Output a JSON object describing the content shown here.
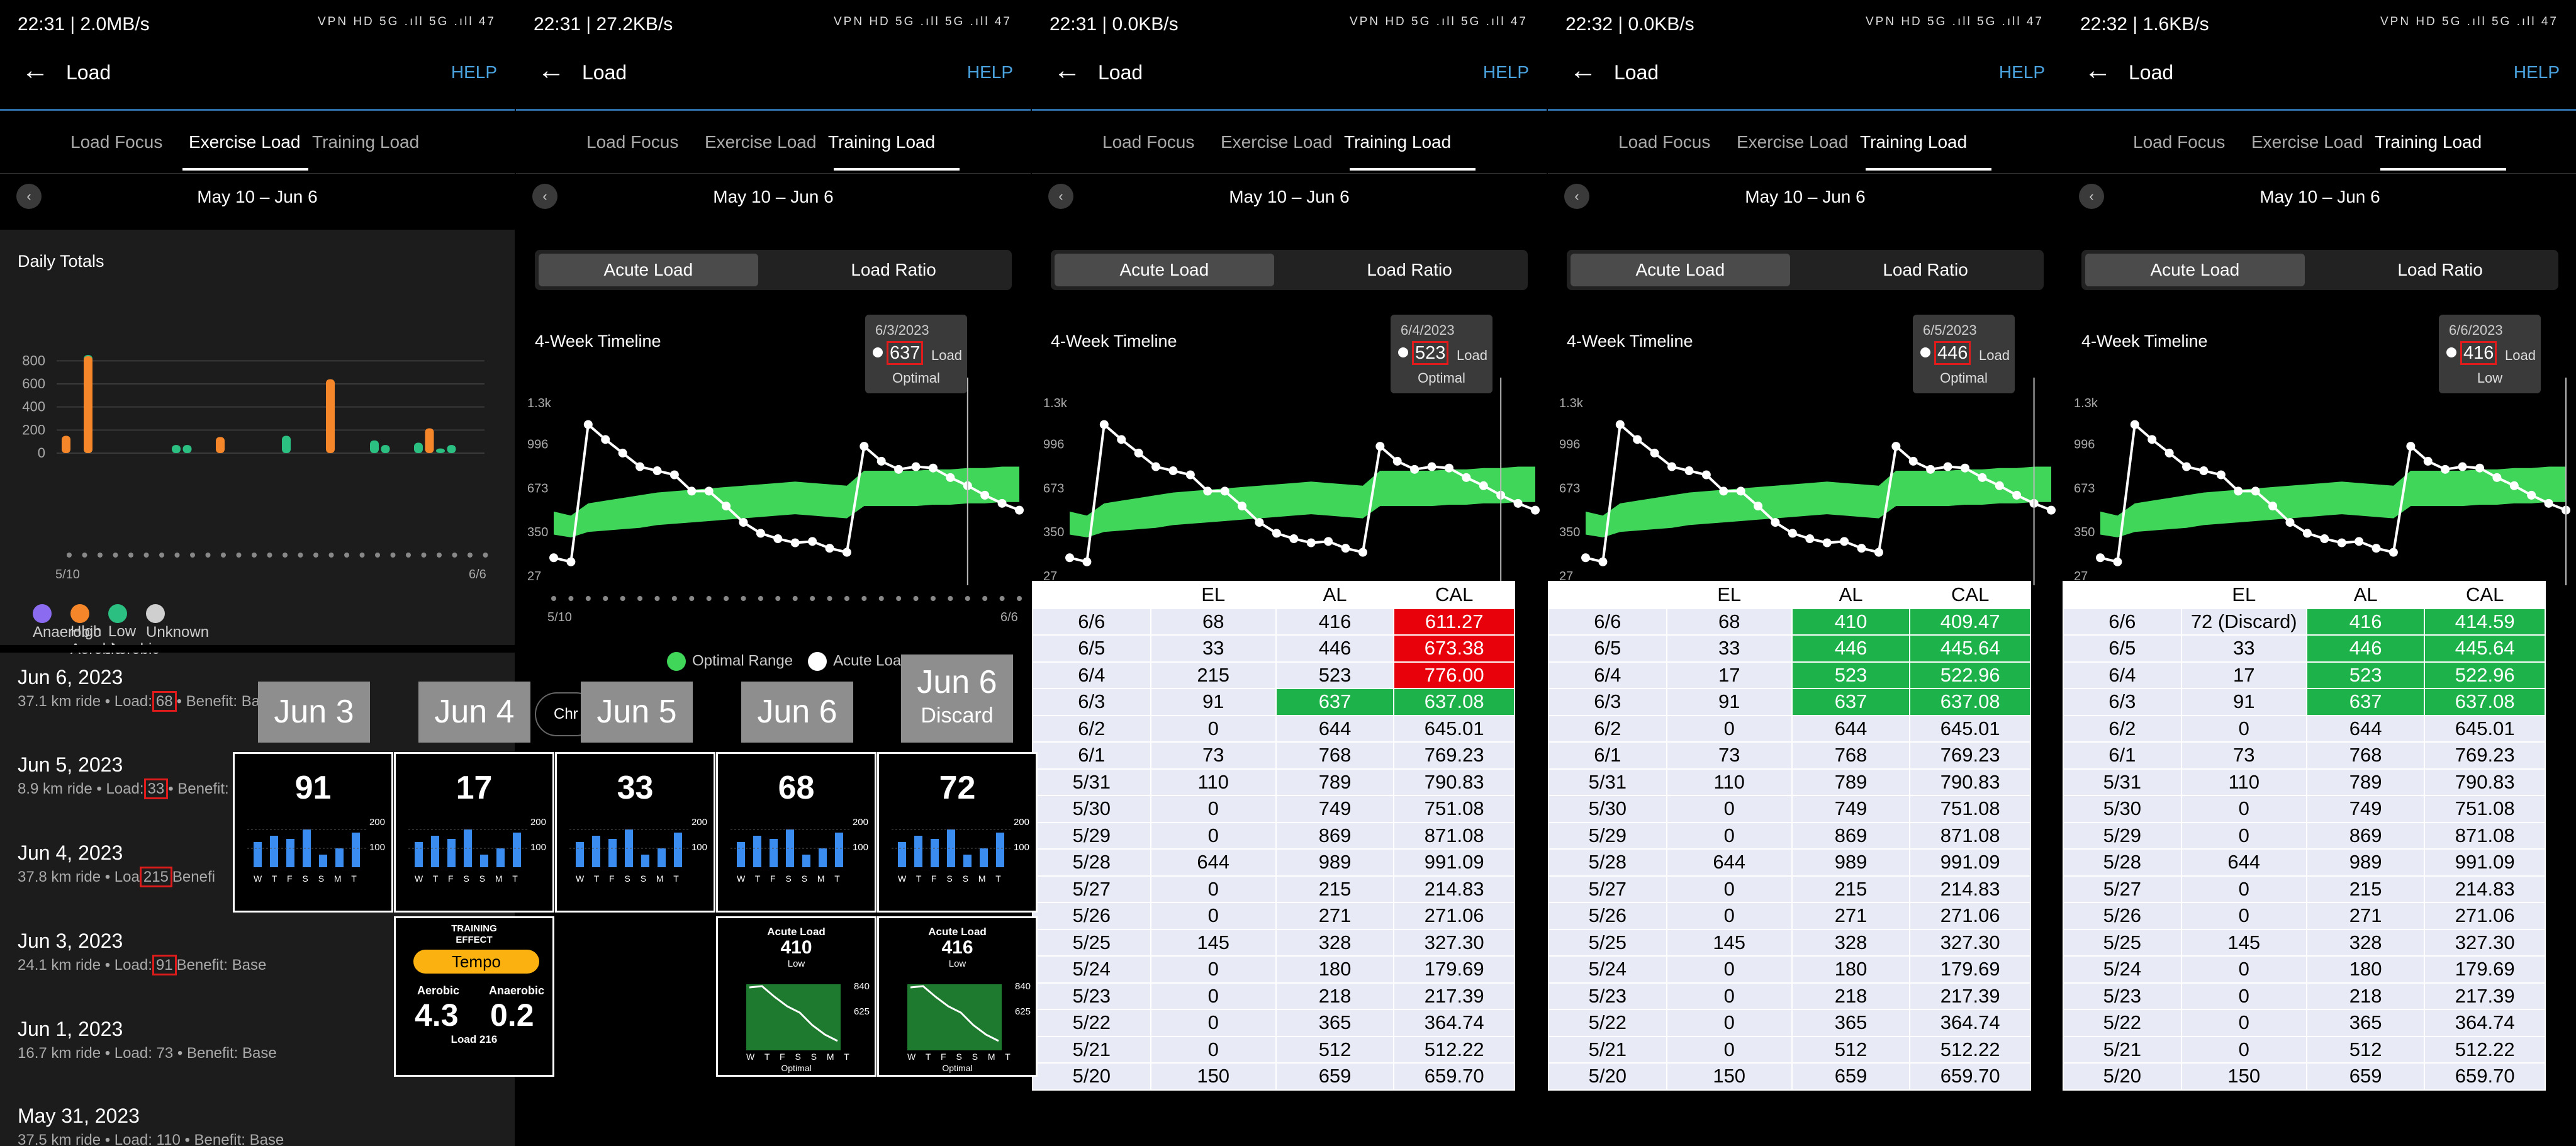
{
  "status": [
    {
      "time": "22:31 | 2.0MB/s"
    },
    {
      "time": "22:31 | 27.2KB/s"
    },
    {
      "time": "22:31 | 0.0KB/s"
    },
    {
      "time": "22:32 | 0.0KB/s"
    },
    {
      "time": "22:32 | 1.6KB/s"
    }
  ],
  "status_icons": "VPN HD 5G .ıll 5G .ıll 47",
  "header": {
    "back": "←",
    "title": "Load",
    "help": "HELP"
  },
  "tabs": [
    "Load Focus",
    "Exercise Load",
    "Training Load"
  ],
  "date_range": "May 10 – Jun 6",
  "prev": "‹",
  "toggle": {
    "acute": "Acute Load",
    "ratio": "Load Ratio"
  },
  "timeline_label": "4-Week Timeline",
  "y_ticks": [
    "1.3k",
    "996",
    "673",
    "350",
    "27"
  ],
  "x_start": "5/10",
  "x_end": "6/6",
  "tooltips": [
    {
      "date": "6/3/2023",
      "value": "637",
      "label": "Load",
      "status": "Optimal"
    },
    {
      "date": "6/4/2023",
      "value": "523",
      "label": "Load",
      "status": "Optimal"
    },
    {
      "date": "6/5/2023",
      "value": "446",
      "label": "Load",
      "status": "Optimal"
    },
    {
      "date": "6/6/2023",
      "value": "416",
      "label": "Load",
      "status": "Low"
    }
  ],
  "legend2": {
    "optimal": "Optimal Range",
    "acute": "Acute Load",
    "chip": "Chr"
  },
  "daily": {
    "title": "Daily Totals",
    "yticks": [
      "800",
      "600",
      "400",
      "200",
      "0"
    ],
    "x_start": "5/10",
    "x_end": "6/6",
    "legend": [
      {
        "name": "Anaerobic",
        "color": "#8b6cf0"
      },
      {
        "name": "High Aerobic",
        "color": "#f5862a"
      },
      {
        "name": "Low Aerobic",
        "color": "#2bbf82"
      },
      {
        "name": "Unknown",
        "color": "#cfcfcf"
      }
    ]
  },
  "activities": [
    {
      "date": "Jun 6, 2023",
      "pre": "37.1 km ride • Load:",
      "load": "68",
      "post": "• Benefit: Bas"
    },
    {
      "date": "Jun 5, 2023",
      "pre": "8.9 km ride • Load:",
      "load": "33",
      "post": "• Benefit:"
    },
    {
      "date": "Jun 4, 2023",
      "pre": "37.8 km ride • Loa",
      "load": "215",
      "post": "Benefi"
    },
    {
      "date": "Jun 3, 2023",
      "pre": "24.1 km ride • Load:",
      "load": "91",
      "post": "Benefit: Base"
    },
    {
      "date": "Jun 1, 2023",
      "pre": "16.7 km ride • Load: 73 • Benefit: Base",
      "load": "",
      "post": ""
    },
    {
      "date": "May 31, 2023",
      "pre": "37.5 km ride • Load: 110 • Benefit: Base",
      "load": "",
      "post": ""
    }
  ],
  "overlay_labels": [
    "Jun 3",
    "Jun 4",
    "Jun 5",
    "Jun 6"
  ],
  "overlay_label5": {
    "a": "Jun 6",
    "b": "Discard"
  },
  "watch_values": [
    "91",
    "17",
    "33",
    "68",
    "72"
  ],
  "watch_scale": {
    "top": "200",
    "mid": "100"
  },
  "watch_days": "W T F S S M T",
  "training_effect": {
    "title1": "TRAINING",
    "title2": "EFFECT",
    "badge": "Tempo",
    "aero_label": "Aerobic",
    "anaero_label": "Anaerobic",
    "aero": "4.3",
    "anaero": "0.2",
    "load": "Load 216"
  },
  "acute_watch": [
    {
      "title": "Acute Load",
      "value": "410",
      "status": "Low",
      "top": "840",
      "mid": "625",
      "footer": "Optimal"
    },
    {
      "title": "Acute Load",
      "value": "416",
      "status": "Low",
      "top": "840",
      "mid": "625",
      "footer": "Optimal"
    }
  ],
  "table_header": [
    "",
    "EL",
    "AL",
    "CAL"
  ],
  "tables": [
    {
      "rows": [
        [
          "6/6",
          "68",
          "416",
          "611.27"
        ],
        [
          "6/5",
          "33",
          "446",
          "673.38"
        ],
        [
          "6/4",
          "215",
          "523",
          "776.00"
        ],
        [
          "6/3",
          "91",
          "637",
          "637.08"
        ],
        [
          "6/2",
          "0",
          "644",
          "645.01"
        ],
        [
          "6/1",
          "73",
          "768",
          "769.23"
        ],
        [
          "5/31",
          "110",
          "789",
          "790.83"
        ],
        [
          "5/30",
          "0",
          "749",
          "751.08"
        ],
        [
          "5/29",
          "0",
          "869",
          "871.08"
        ],
        [
          "5/28",
          "644",
          "989",
          "991.09"
        ],
        [
          "5/27",
          "0",
          "215",
          "214.83"
        ],
        [
          "5/26",
          "0",
          "271",
          "271.06"
        ],
        [
          "5/25",
          "145",
          "328",
          "327.30"
        ],
        [
          "5/24",
          "0",
          "180",
          "179.69"
        ],
        [
          "5/23",
          "0",
          "218",
          "217.39"
        ],
        [
          "5/22",
          "0",
          "365",
          "364.74"
        ],
        [
          "5/21",
          "0",
          "512",
          "512.22"
        ],
        [
          "5/20",
          "150",
          "659",
          "659.70"
        ]
      ],
      "colors": {
        "0": [
          "",
          "",
          "",
          "r"
        ],
        "1": [
          "",
          "",
          "",
          "r"
        ],
        "2": [
          "",
          "",
          "",
          "r"
        ],
        "3": [
          "",
          "",
          "g",
          "g"
        ]
      }
    },
    {
      "rows": [
        [
          "6/6",
          "68",
          "410",
          "409.47"
        ],
        [
          "6/5",
          "33",
          "446",
          "445.64"
        ],
        [
          "6/4",
          "17",
          "523",
          "522.96"
        ],
        [
          "6/3",
          "91",
          "637",
          "637.08"
        ],
        [
          "6/2",
          "0",
          "644",
          "645.01"
        ],
        [
          "6/1",
          "73",
          "768",
          "769.23"
        ],
        [
          "5/31",
          "110",
          "789",
          "790.83"
        ],
        [
          "5/30",
          "0",
          "749",
          "751.08"
        ],
        [
          "5/29",
          "0",
          "869",
          "871.08"
        ],
        [
          "5/28",
          "644",
          "989",
          "991.09"
        ],
        [
          "5/27",
          "0",
          "215",
          "214.83"
        ],
        [
          "5/26",
          "0",
          "271",
          "271.06"
        ],
        [
          "5/25",
          "145",
          "328",
          "327.30"
        ],
        [
          "5/24",
          "0",
          "180",
          "179.69"
        ],
        [
          "5/23",
          "0",
          "218",
          "217.39"
        ],
        [
          "5/22",
          "0",
          "365",
          "364.74"
        ],
        [
          "5/21",
          "0",
          "512",
          "512.22"
        ],
        [
          "5/20",
          "150",
          "659",
          "659.70"
        ]
      ],
      "colors": {
        "0": [
          "",
          "",
          "g",
          "g"
        ],
        "1": [
          "",
          "",
          "g",
          "g"
        ],
        "2": [
          "",
          "",
          "g",
          "g"
        ],
        "3": [
          "",
          "",
          "g",
          "g"
        ]
      }
    },
    {
      "rows": [
        [
          "6/6",
          "72 (Discard)",
          "416",
          "414.59"
        ],
        [
          "6/5",
          "33",
          "446",
          "445.64"
        ],
        [
          "6/4",
          "17",
          "523",
          "522.96"
        ],
        [
          "6/3",
          "91",
          "637",
          "637.08"
        ],
        [
          "6/2",
          "0",
          "644",
          "645.01"
        ],
        [
          "6/1",
          "73",
          "768",
          "769.23"
        ],
        [
          "5/31",
          "110",
          "789",
          "790.83"
        ],
        [
          "5/30",
          "0",
          "749",
          "751.08"
        ],
        [
          "5/29",
          "0",
          "869",
          "871.08"
        ],
        [
          "5/28",
          "644",
          "989",
          "991.09"
        ],
        [
          "5/27",
          "0",
          "215",
          "214.83"
        ],
        [
          "5/26",
          "0",
          "271",
          "271.06"
        ],
        [
          "5/25",
          "145",
          "328",
          "327.30"
        ],
        [
          "5/24",
          "0",
          "180",
          "179.69"
        ],
        [
          "5/23",
          "0",
          "218",
          "217.39"
        ],
        [
          "5/22",
          "0",
          "365",
          "364.74"
        ],
        [
          "5/21",
          "0",
          "512",
          "512.22"
        ],
        [
          "5/20",
          "150",
          "659",
          "659.70"
        ]
      ],
      "colors": {
        "0": [
          "",
          "",
          "g",
          "g"
        ],
        "1": [
          "",
          "",
          "g",
          "g"
        ],
        "2": [
          "",
          "",
          "g",
          "g"
        ],
        "3": [
          "",
          "",
          "g",
          "g"
        ]
      }
    }
  ],
  "chart_data": [
    {
      "type": "area",
      "name_note": "",
      "y_ticks": [
        "1.3k",
        "996",
        "673",
        "350",
        "27"
      ],
      "acute": [
        160,
        130,
        1140,
        1030,
        930,
        830,
        800,
        770,
        650,
        650,
        540,
        420,
        340,
        300,
        270,
        280,
        230,
        200,
        980,
        870,
        810,
        830,
        820,
        750,
        690,
        620,
        560,
        510
      ],
      "band_low": [
        330,
        310,
        350,
        360,
        370,
        380,
        400,
        410,
        420,
        430,
        440,
        450,
        460,
        470,
        480,
        470,
        460,
        450,
        540,
        540,
        540,
        540,
        550,
        550,
        560,
        560,
        570,
        570
      ],
      "band_high": [
        500,
        470,
        560,
        580,
        600,
        620,
        640,
        650,
        660,
        670,
        680,
        690,
        700,
        710,
        720,
        710,
        700,
        690,
        800,
        800,
        800,
        800,
        810,
        810,
        820,
        820,
        830,
        830
      ]
    },
    {
      "type": "bar",
      "y_ticks": [
        "800",
        "600",
        "400",
        "200",
        "0"
      ],
      "ylim": [
        0,
        900
      ],
      "bars": [
        {
          "x": 0,
          "v": 150,
          "c": "#f5862a"
        },
        {
          "x": 1,
          "v": 850,
          "c": "#2bbf82"
        },
        {
          "x": 1,
          "v": 840,
          "c": "#f5862a"
        },
        {
          "x": 5,
          "v": 70,
          "c": "#2bbf82"
        },
        {
          "x": 5.5,
          "v": 70,
          "c": "#2bbf82"
        },
        {
          "x": 7,
          "v": 140,
          "c": "#f5862a"
        },
        {
          "x": 10,
          "v": 150,
          "c": "#2bbf82"
        },
        {
          "x": 12,
          "v": 640,
          "c": "#f5862a"
        },
        {
          "x": 14,
          "v": 110,
          "c": "#2bbf82"
        },
        {
          "x": 14.5,
          "v": 70,
          "c": "#2bbf82"
        },
        {
          "x": 16,
          "v": 90,
          "c": "#2bbf82"
        },
        {
          "x": 16.5,
          "v": 215,
          "c": "#f5862a"
        },
        {
          "x": 17,
          "v": 40,
          "c": "#2bbf82"
        },
        {
          "x": 17.5,
          "v": 70,
          "c": "#2bbf82"
        }
      ]
    }
  ]
}
